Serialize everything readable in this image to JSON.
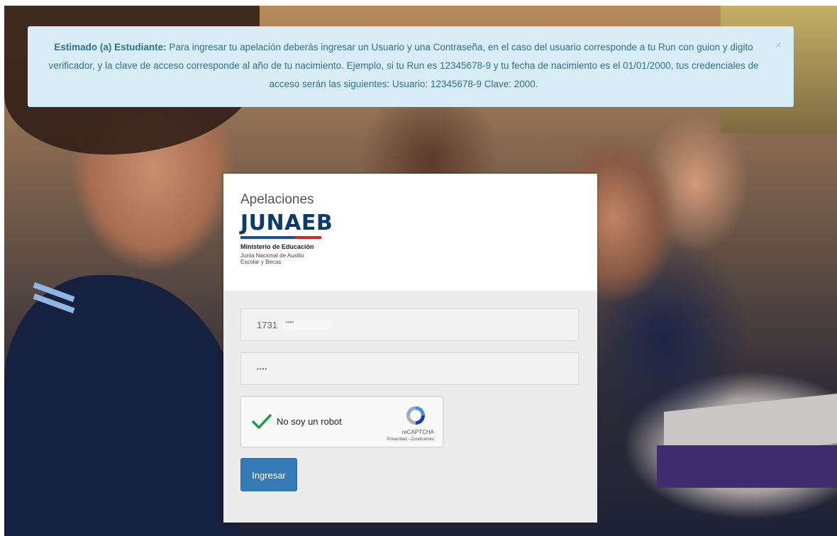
{
  "alert": {
    "prefix": "Estimado (a) Estudiante:",
    "message": " Para ingresar tu apelación deberás ingresar un Usuario y una Contraseña, en el caso del usuario corresponde a tu Run con guion y digito verificador, y la clave de acceso corresponde al año de tu nacimiento. Ejemplo, si tu Run es 12345678-9 y tu fecha de nacimiento es el 01/01/2000, tus credenciales de acceso serán las siguientes: Usuario: 12345678-9 Clave: 2000.",
    "close_icon": "×"
  },
  "card": {
    "app_title": "Apelaciones",
    "logo": {
      "word": "JUNAEB",
      "ministry": "Ministerio de Educación",
      "sub_line1": "Junta Nacional de Auxilio",
      "sub_line2": "Escolar y Becas"
    },
    "username_value": "1731",
    "password_value": "••••",
    "recaptcha": {
      "label": "No soy un robot",
      "brand": "reCAPTCHA",
      "links": "Privacidad - Condiciones",
      "checked": true
    },
    "submit_label": "Ingresar"
  },
  "colors": {
    "alert_bg": "#d9edf7",
    "alert_text": "#31708f",
    "button": "#337ab7",
    "logo_blue": "#0b3a6e",
    "logo_red": "#d52b1e"
  }
}
